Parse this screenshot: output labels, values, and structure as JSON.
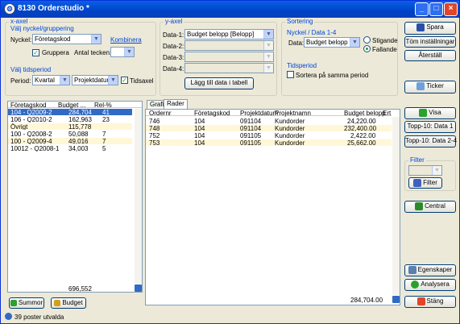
{
  "window": {
    "title": "8130 Orderstudio *"
  },
  "xaxis": {
    "group": "x-axel",
    "sub_group": "Välj nyckel/gruppering",
    "key_label": "Nyckel:",
    "key_value": "Företagskod",
    "combine": "Kombinera",
    "group_check": "Gruppera",
    "chars_label": "Antal tecken:",
    "period_group": "Välj tidsperiod",
    "period_label": "Period:",
    "period_value": "Kvartal",
    "date_value": "Projektdatum",
    "timeaxis": "Tidsaxel"
  },
  "yaxis": {
    "group": "y-axel",
    "data1_label": "Data-1:",
    "data1_value": "Budget belopp [Belopp]",
    "data2_label": "Data-2:",
    "data3_label": "Data-3:",
    "data4_label": "Data-4:",
    "add_button": "Lägg till data i tabell"
  },
  "sort": {
    "group": "Sortering",
    "sub_group": "Nyckel / Data 1-4",
    "data_label": "Data:",
    "data_value": "Budget belopp",
    "asc": "Stigande",
    "desc": "Fallande",
    "period_group": "Tidsperiod",
    "same_period": "Sortera på samma period"
  },
  "right": {
    "save": "Spara",
    "clear": "Töm inställningar",
    "reset": "Återställ",
    "ticker": "Ticker",
    "show": "Visa",
    "top1": "Topp-10: Data 1",
    "top24": "Topp-10: Data 2-4",
    "filter_group": "Filter",
    "filter": "Filter",
    "central": "Central",
    "properties": "Egenskaper",
    "analyze": "Analysera",
    "close": "Stäng"
  },
  "left_table": {
    "headers": [
      "Företagskod",
      "Budget ...",
      "Rel-%"
    ],
    "rows": [
      [
        "104 - Q2009-2",
        "284,704",
        "41"
      ],
      [
        "106 - Q2010-2",
        "162,963",
        "23"
      ],
      [
        "Övrigt",
        "115,778",
        ""
      ],
      [
        "100 - Q2008-2",
        "50,088",
        "7"
      ],
      [
        "100 - Q2009-4",
        "49,016",
        "7"
      ],
      [
        "10012 - Q2008-1",
        "34,003",
        "5"
      ]
    ],
    "total": "696,552",
    "sum_button": "Summor",
    "budget_button": "Budget"
  },
  "detail": {
    "tabs": [
      "Grafik",
      "Rader"
    ],
    "headers": [
      "Ordernr",
      "Företagskod",
      "Projektdatum",
      "Projektnamn",
      "Budget belopp",
      "Ert"
    ],
    "rows": [
      [
        "746",
        "104",
        "091104",
        "Kundorder",
        "24,220.00"
      ],
      [
        "748",
        "104",
        "091104",
        "Kundorder",
        "232,400.00"
      ],
      [
        "752",
        "104",
        "091105",
        "Kundorder",
        "2,422.00"
      ],
      [
        "753",
        "104",
        "091105",
        "Kundorder",
        "25,662.00"
      ]
    ],
    "total": "284,704.00"
  },
  "status": {
    "text": "39 poster utvalda"
  },
  "colors": {
    "title": "#0a5fe6",
    "selection": "#316ac5",
    "highlight": "#fff7d6",
    "group_label": "#0046d5"
  }
}
